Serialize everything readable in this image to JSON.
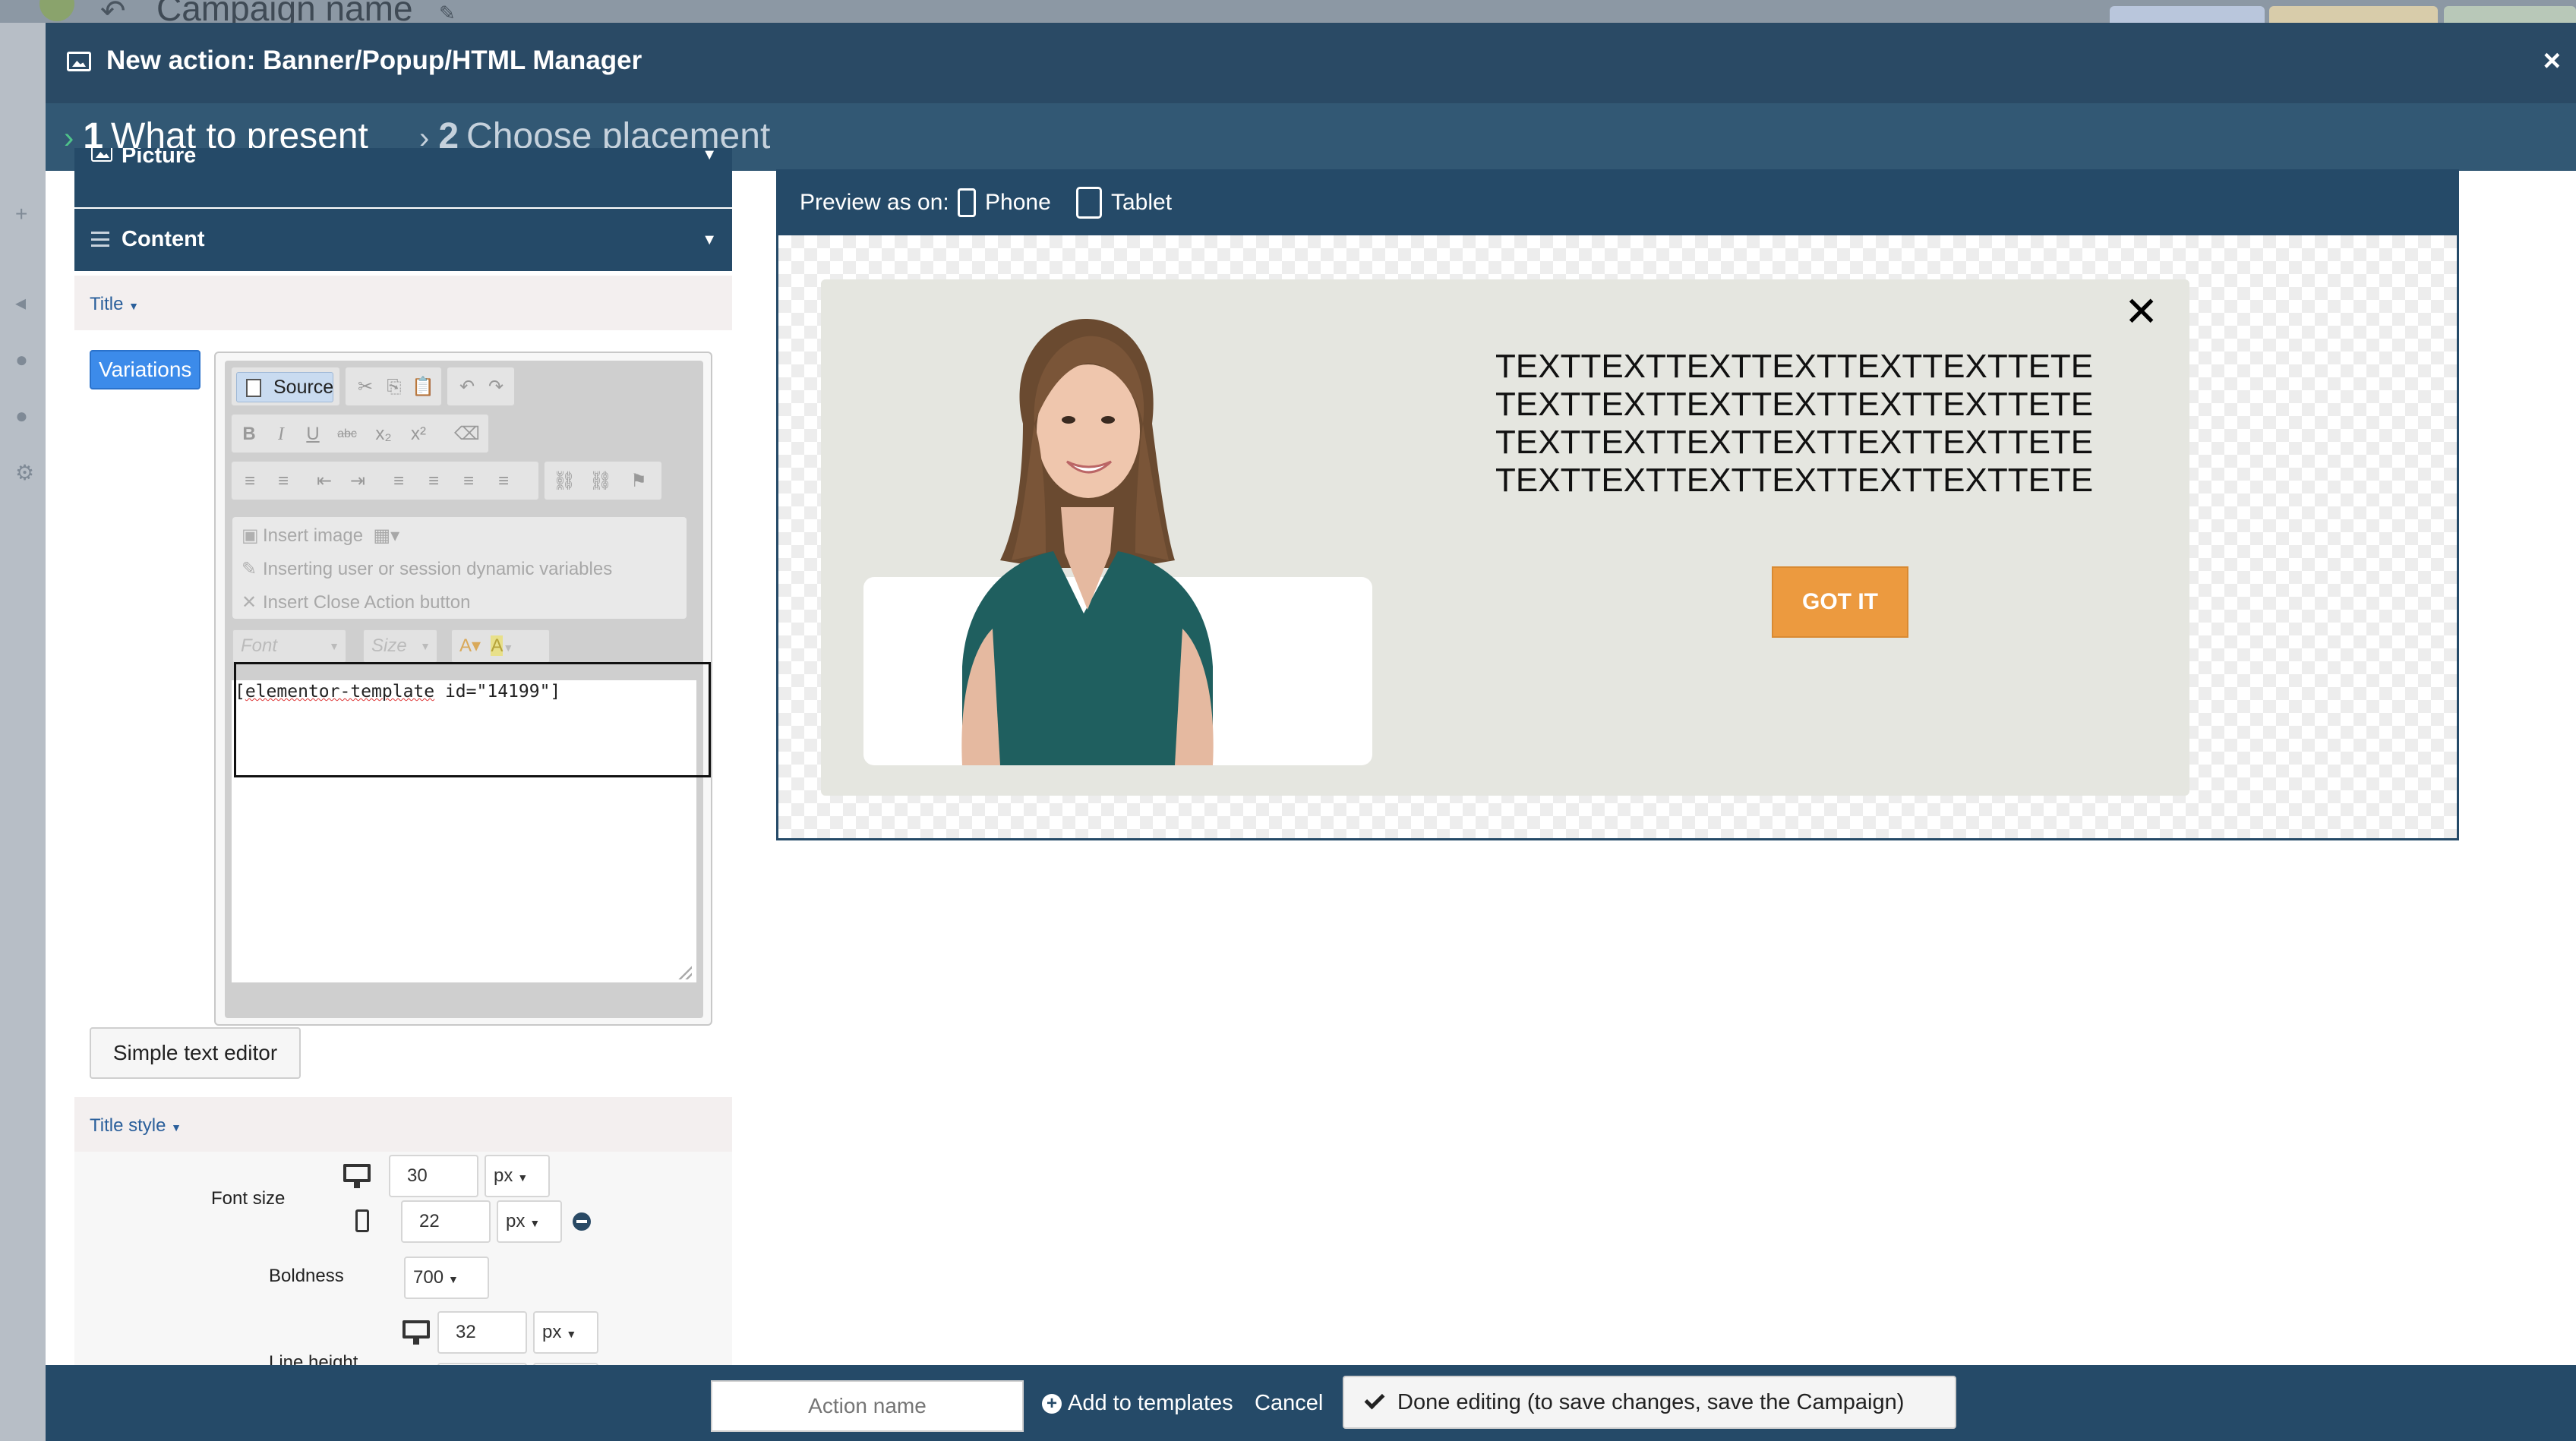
{
  "background": {
    "title": "Campaign name"
  },
  "modal": {
    "title": "New action: Banner/Popup/HTML Manager",
    "close": "×",
    "steps": [
      {
        "num": "1",
        "label": "What to present"
      },
      {
        "num": "2",
        "label": "Choose placement"
      }
    ]
  },
  "left_panel": {
    "picture_section": "Picture",
    "content_section": "Content",
    "title_dropdown": "Title",
    "variations": "Variations",
    "editor": {
      "source": "Source",
      "insert_image": "Insert image",
      "insert_variables": "Inserting user or session dynamic variables",
      "insert_close": "Insert Close Action button",
      "font_placeholder": "Font",
      "size_placeholder": "Size",
      "code_part1": "elementor-template",
      "code_part2": " id=\"14199\"]",
      "code_open": "["
    },
    "simple_text_editor": "Simple text editor",
    "title_style": "Title style",
    "font_size_label": "Font size",
    "font_size_desktop": "30",
    "font_size_mobile": "22",
    "unit": "px",
    "boldness_label": "Boldness",
    "boldness_value": "700",
    "line_height_label": "Line height",
    "line_height_desktop": "32"
  },
  "preview": {
    "label": "Preview as on:",
    "phone": "Phone",
    "tablet": "Tablet",
    "banner_text": "TEXTTEXTTEXTTEXTTEXTTEXTTETE TEXTTEXTTEXTTEXTTEXTTEXTTETE TEXTTEXTTEXTTEXTTEXTTEXTTETE TEXTTEXTTEXTTEXTTEXTTEXTTETE",
    "button": "GOT IT",
    "close": "✕"
  },
  "footer": {
    "action_name_placeholder": "Action name",
    "add_to_templates": "Add to templates",
    "cancel": "Cancel",
    "done": "Done editing (to save changes, save the Campaign)"
  },
  "colors": {
    "header": "#2a4a65",
    "steps": "#325874",
    "accent": "#3c8bea",
    "button": "#ec9a3f",
    "step_chevron": "#4fc38a"
  }
}
